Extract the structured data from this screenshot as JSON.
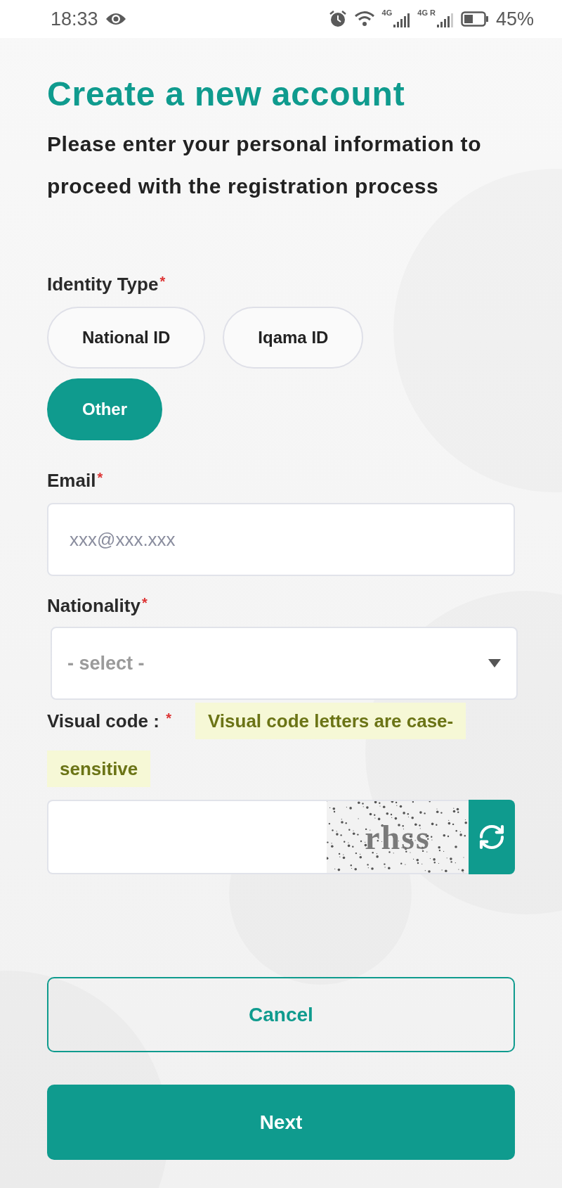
{
  "status_bar": {
    "time": "18:33",
    "network_1": "4G",
    "network_2": "4G R",
    "battery": "45%"
  },
  "title": "Create a new account",
  "subtitle": "Please enter your personal information to proceed with the registration process",
  "identity_type": {
    "label": "Identity Type",
    "required_mark": "*",
    "options": [
      {
        "label": "National ID",
        "selected": false
      },
      {
        "label": "Iqama ID",
        "selected": false
      },
      {
        "label": "Other",
        "selected": true
      }
    ]
  },
  "email": {
    "label": "Email",
    "required_mark": "*",
    "placeholder": "xxx@xxx.xxx"
  },
  "nationality": {
    "label": "Nationality",
    "required_mark": "*",
    "placeholder": "- select -"
  },
  "visual_code": {
    "label": "Visual code :",
    "required_mark": "*",
    "hint_lines": [
      "Visual code letters are case-",
      "sensitive"
    ],
    "captcha": "rhss"
  },
  "buttons": [
    {
      "label": "Cancel",
      "kind": "outline"
    },
    {
      "label": "Next",
      "kind": "primary"
    }
  ]
}
